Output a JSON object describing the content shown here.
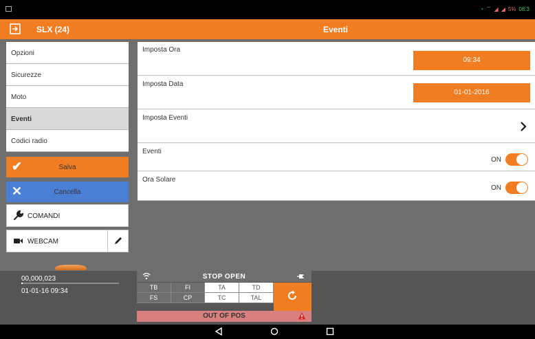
{
  "status_bar": {
    "battery": "5%",
    "time": "08:3"
  },
  "title_bar": {
    "app_title": "SLX (24)",
    "page_title": "Eventi"
  },
  "sidebar": {
    "menu": [
      {
        "label": "Opzioni",
        "active": false
      },
      {
        "label": "Sicurezze",
        "active": false
      },
      {
        "label": "Moto",
        "active": false
      },
      {
        "label": "Eventi",
        "active": true
      },
      {
        "label": "Codici radio",
        "active": false
      }
    ],
    "save_label": "Salva",
    "cancel_label": "Cancella",
    "commands_label": "COMANDI",
    "webcam_label": "WEBCAM"
  },
  "settings": {
    "time_label": "Imposta Ora",
    "time_value": "09:34",
    "date_label": "Imposta Data",
    "date_value": "01-01-2016",
    "events_setup_label": "Imposta Eventi",
    "events_label": "Eventi",
    "events_state": "ON",
    "daylight_label": "Ora Solare",
    "daylight_state": "ON"
  },
  "bottom": {
    "position": "00,000,023",
    "datetime": "01-01-16 09:34",
    "status_title": "STOP OPEN",
    "grid": [
      [
        "TB",
        "FI",
        "TA",
        "TD"
      ],
      [
        "FS",
        "CP",
        "TC",
        "TAL"
      ]
    ],
    "out_of_pos": "OUT OF POS"
  },
  "colors": {
    "accent": "#f07d21",
    "cancel": "#4b7fd4",
    "alert": "#d7807f"
  }
}
